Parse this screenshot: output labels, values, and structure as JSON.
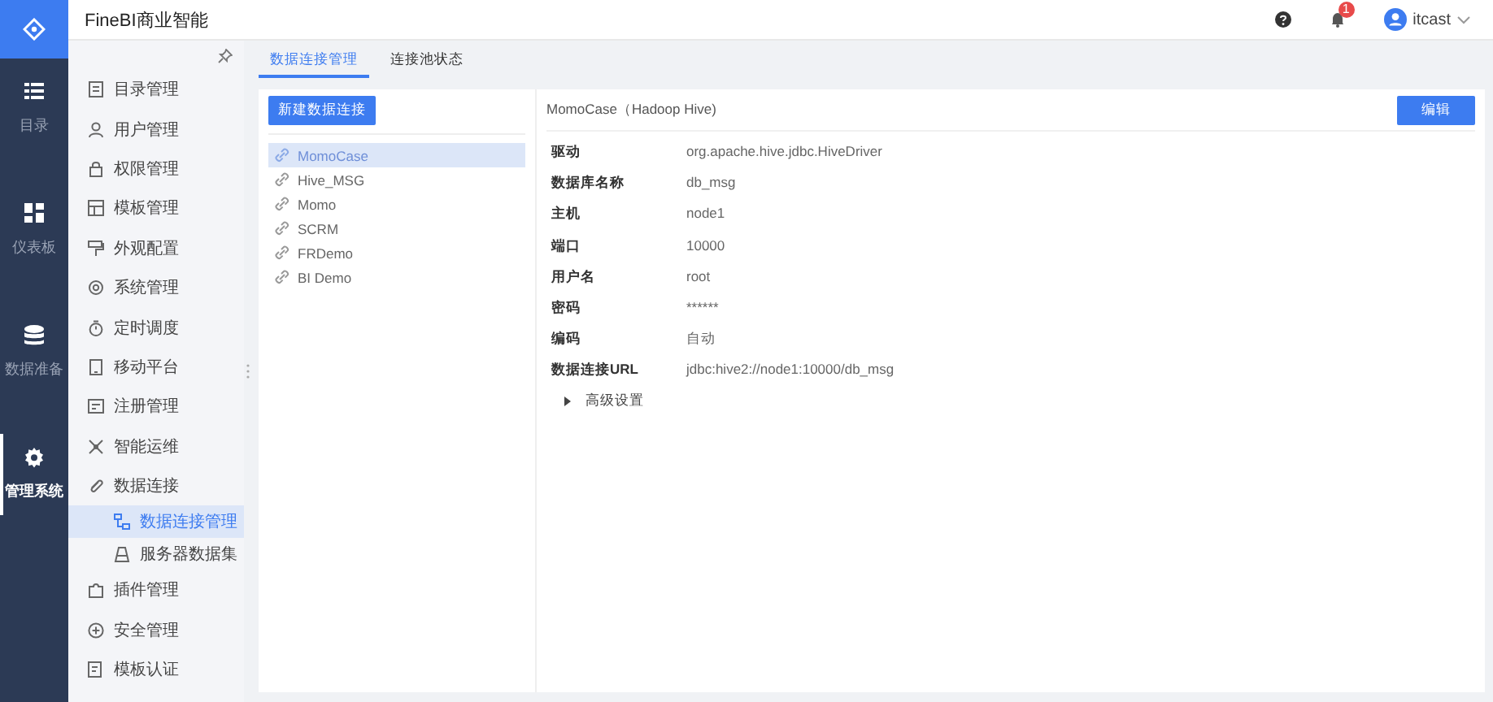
{
  "app": {
    "title": "FineBI商业智能"
  },
  "rail": [
    {
      "label": "目录",
      "selected": false
    },
    {
      "label": "仪表板",
      "selected": false
    },
    {
      "label": "数据准备",
      "selected": false
    },
    {
      "label": "管理系统",
      "selected": true
    }
  ],
  "header": {
    "notifications": "1",
    "user": "itcast"
  },
  "sidebar": {
    "items": [
      {
        "label": "目录管理",
        "selected": false
      },
      {
        "label": "用户管理",
        "selected": false
      },
      {
        "label": "权限管理",
        "selected": false
      },
      {
        "label": "模板管理",
        "selected": false
      },
      {
        "label": "外观配置",
        "selected": false
      },
      {
        "label": "系统管理",
        "selected": false
      },
      {
        "label": "定时调度",
        "selected": false
      },
      {
        "label": "移动平台",
        "selected": false
      },
      {
        "label": "注册管理",
        "selected": false
      },
      {
        "label": "智能运维",
        "selected": false
      },
      {
        "label": "数据连接",
        "selected": false,
        "expanded": true,
        "children": [
          {
            "label": "数据连接管理",
            "selected": true
          },
          {
            "label": "服务器数据集",
            "selected": false
          }
        ]
      },
      {
        "label": "插件管理",
        "selected": false
      },
      {
        "label": "安全管理",
        "selected": false
      },
      {
        "label": "模板认证",
        "selected": false
      }
    ]
  },
  "tabs": [
    {
      "label": "数据连接管理",
      "selected": true
    },
    {
      "label": "连接池状态",
      "selected": false
    }
  ],
  "new_button": "新建数据连接",
  "connections": [
    {
      "name": "MomoCase",
      "selected": true
    },
    {
      "name": "Hive_MSG",
      "selected": false
    },
    {
      "name": "Momo",
      "selected": false
    },
    {
      "name": "SCRM",
      "selected": false
    },
    {
      "name": "FRDemo",
      "selected": false
    },
    {
      "name": "BI Demo",
      "selected": false
    }
  ],
  "detail": {
    "title": "MomoCase（Hadoop Hive)",
    "edit_button": "编辑",
    "fields": [
      {
        "label": "驱动",
        "value": "org.apache.hive.jdbc.HiveDriver"
      },
      {
        "label": "数据库名称",
        "value": "db_msg"
      },
      {
        "label": "主机",
        "value": "node1"
      },
      {
        "label": "端口",
        "value": "10000"
      },
      {
        "label": "用户名",
        "value": "root"
      },
      {
        "label": "密码",
        "value": "******"
      },
      {
        "label": "编码",
        "value": "自动"
      },
      {
        "label": "数据连接URL",
        "value": "jdbc:hive2://node1:10000/db_msg"
      }
    ],
    "advanced": {
      "label": "高级设置",
      "expanded": false
    }
  }
}
